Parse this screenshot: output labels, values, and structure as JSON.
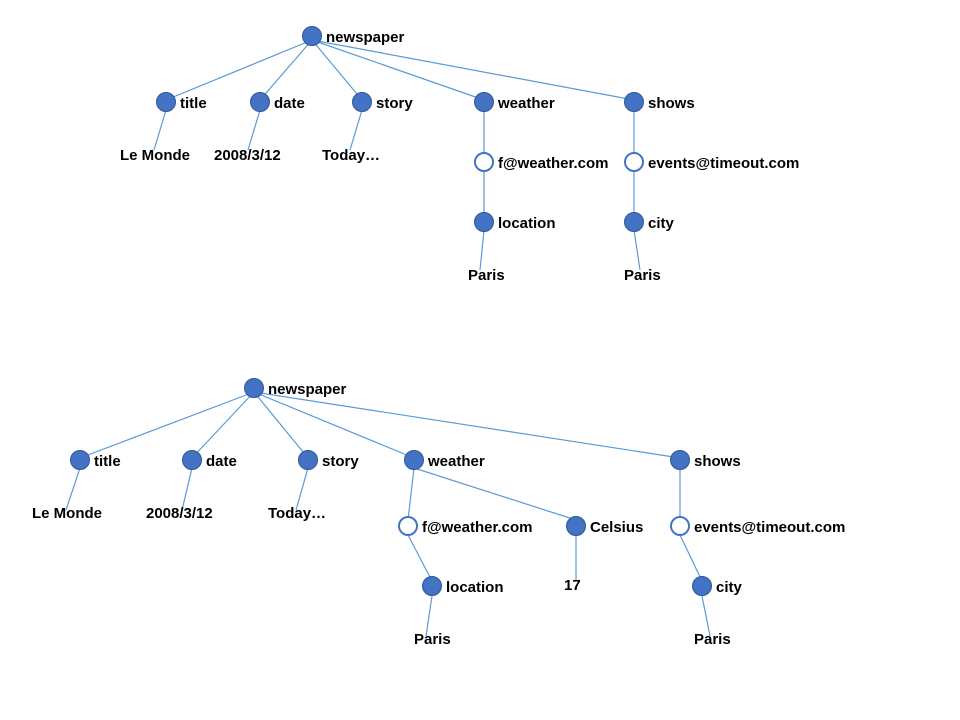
{
  "colors": {
    "node_fill": "#4472c4",
    "edge": "#5b9bd5",
    "text": "#000"
  },
  "tree1": {
    "root": "newspaper",
    "title_label": "title",
    "title_value": "Le Monde",
    "date_label": "date",
    "date_value": "2008/3/12",
    "story_label": "story",
    "story_value": "Today…",
    "weather_label": "weather",
    "weather_fn": "f@weather.com",
    "location_label": "location",
    "location_value": "Paris",
    "shows_label": "shows",
    "shows_fn": "events@timeout.com",
    "city_label": "city",
    "city_value": "Paris"
  },
  "tree2": {
    "root": "newspaper",
    "title_label": "title",
    "title_value": "Le Monde",
    "date_label": "date",
    "date_value": "2008/3/12",
    "story_label": "story",
    "story_value": "Today…",
    "weather_label": "weather",
    "weather_fn": "f@weather.com",
    "celsius_label": "Celsius",
    "celsius_value": "17",
    "location_label": "location",
    "location_value": "Paris",
    "shows_label": "shows",
    "shows_fn": "events@timeout.com",
    "city_label": "city",
    "city_value": "Paris"
  }
}
